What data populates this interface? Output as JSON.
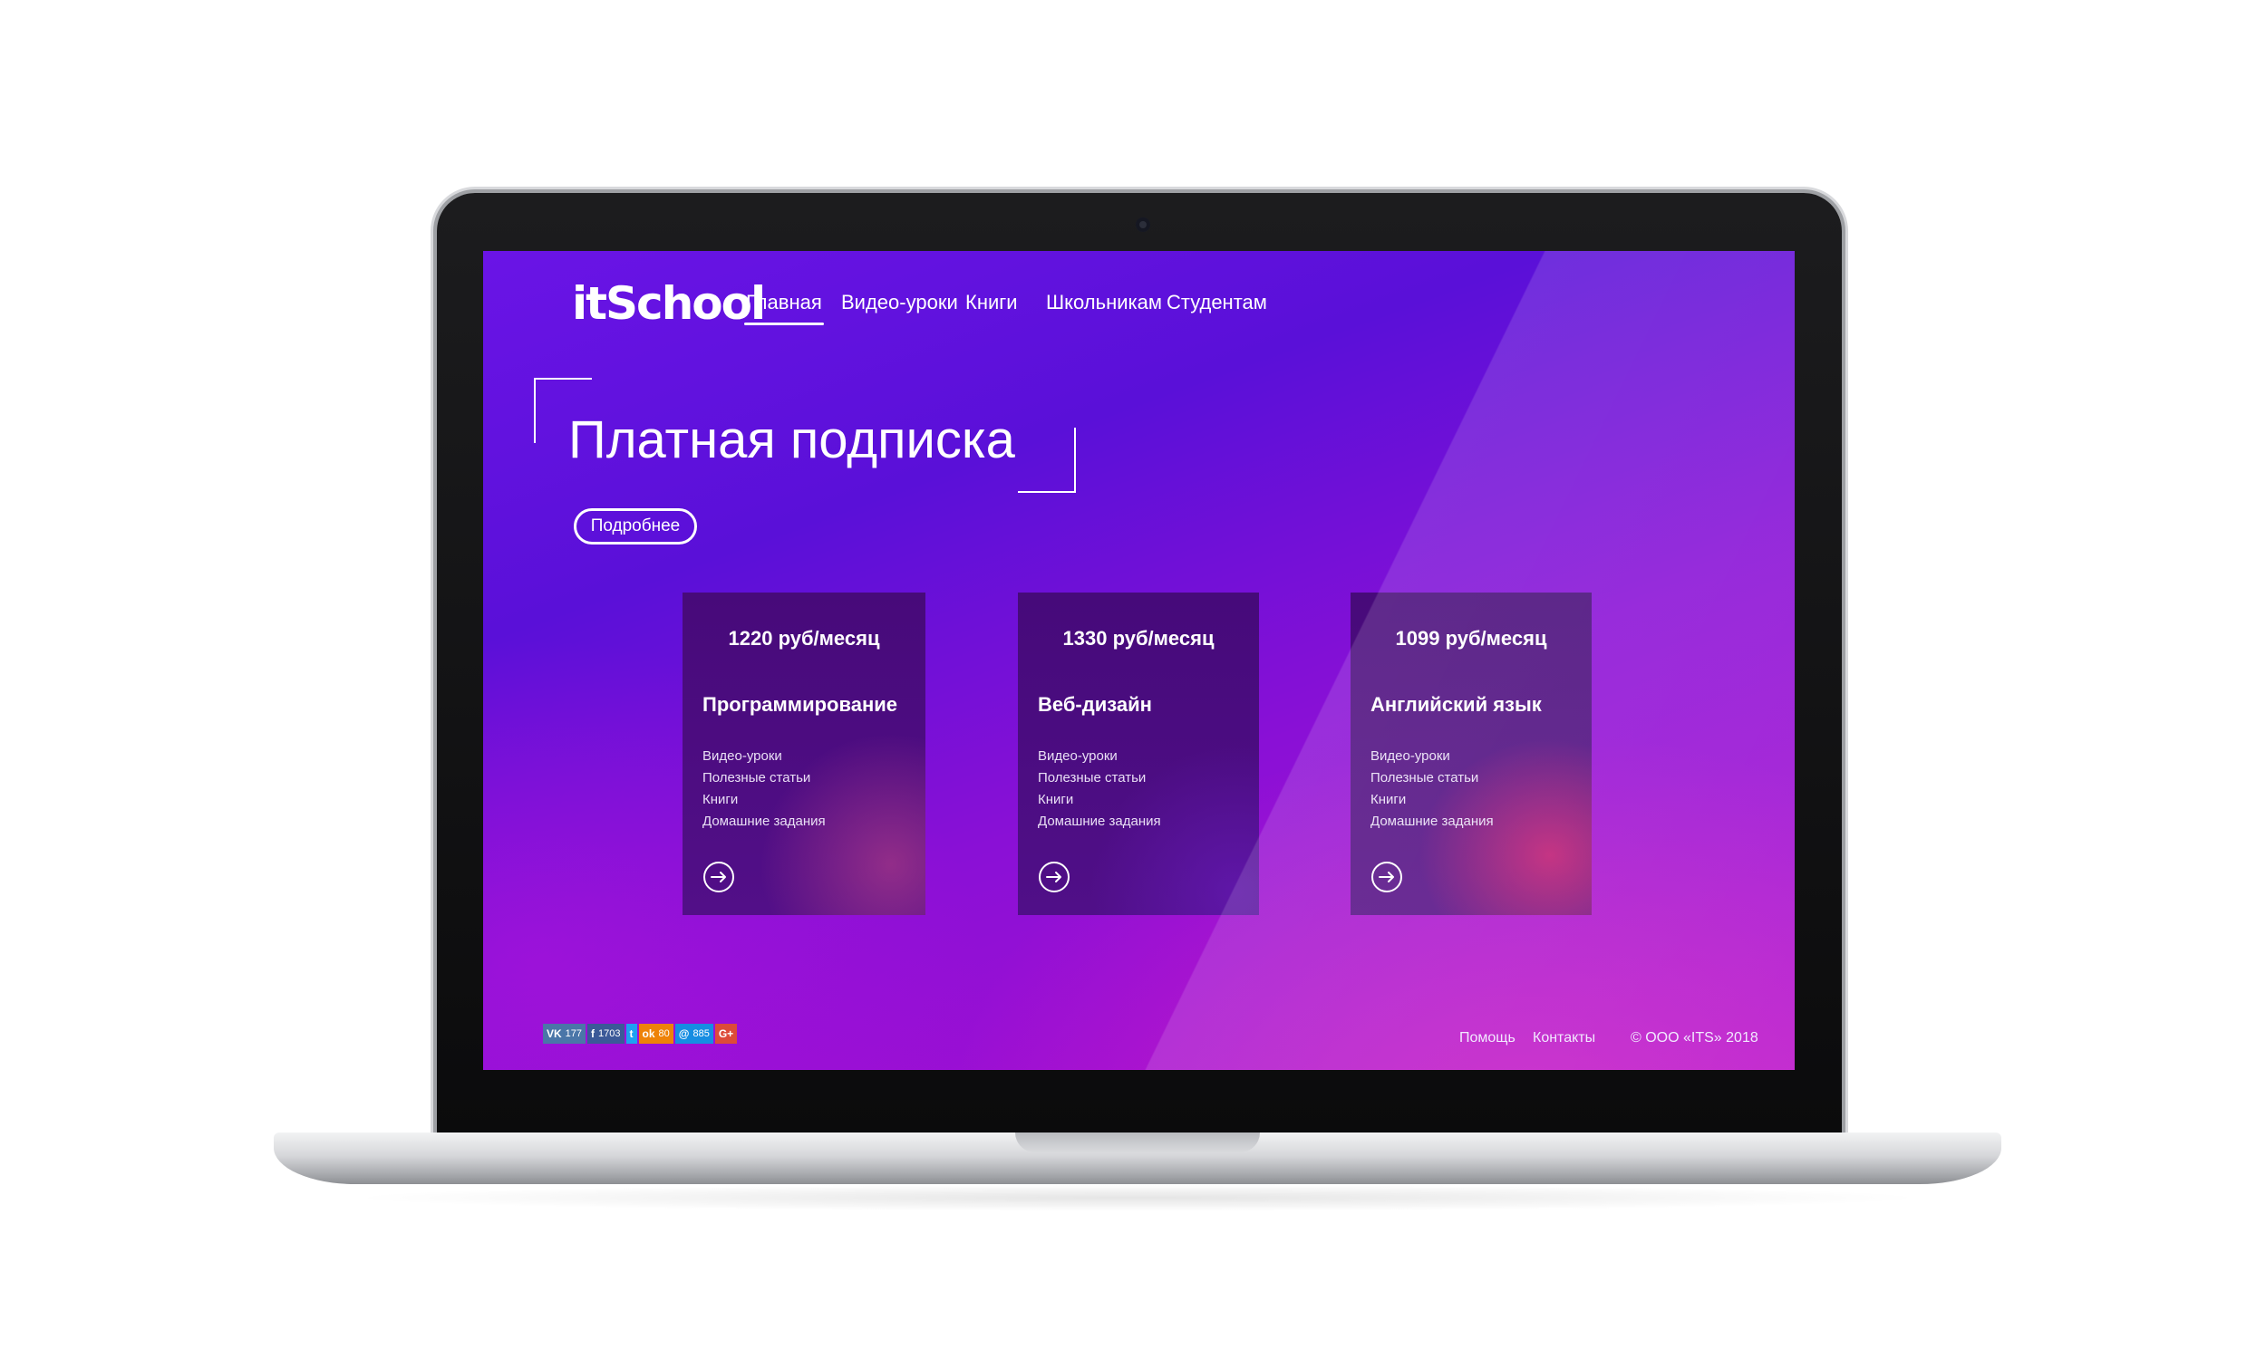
{
  "brand": {
    "logo": "itSchool"
  },
  "nav": {
    "items": [
      {
        "label": "Главная",
        "active": true
      },
      {
        "label": "Видео-уроки",
        "active": false
      },
      {
        "label": "Книги",
        "active": false
      },
      {
        "label": "Школьникам",
        "active": false
      },
      {
        "label": "Студентам",
        "active": false
      }
    ]
  },
  "hero": {
    "title": "Платная подписка",
    "more_label": "Подробнее"
  },
  "cards": [
    {
      "price": "1220 руб/месяц",
      "title": "Программирование",
      "features": [
        "Видео-уроки",
        "Полезные статьи",
        "Книги",
        "Домашние задания"
      ],
      "arrow_icon": "arrow-right-circle-icon"
    },
    {
      "price": "1330 руб/месяц",
      "title": "Веб-дизайн",
      "features": [
        "Видео-уроки",
        "Полезные статьи",
        "Книги",
        "Домашние задания"
      ],
      "arrow_icon": "arrow-right-circle-icon"
    },
    {
      "price": "1099 руб/месяц",
      "title": "Английский язык",
      "features": [
        "Видео-уроки",
        "Полезные статьи",
        "Книги",
        "Домашние задания"
      ],
      "arrow_icon": "arrow-right-circle-icon"
    }
  ],
  "social": [
    {
      "network": "vk",
      "icon": "vk-icon",
      "glyph": "VK",
      "count": "177",
      "color": "#4a76a8"
    },
    {
      "network": "facebook",
      "icon": "facebook-icon",
      "glyph": "f",
      "count": "1703",
      "color": "#3b5998"
    },
    {
      "network": "twitter",
      "icon": "twitter-icon",
      "glyph": "t",
      "count": "",
      "color": "#1da1f2"
    },
    {
      "network": "odnoklassniki",
      "icon": "odnoklassniki-icon",
      "glyph": "ok",
      "count": "80",
      "color": "#ee8208"
    },
    {
      "network": "moimir",
      "icon": "moimir-icon",
      "glyph": "@",
      "count": "885",
      "color": "#168de2"
    },
    {
      "network": "googleplus",
      "icon": "googleplus-icon",
      "glyph": "G+",
      "count": "",
      "color": "#dd4b39"
    }
  ],
  "footer": {
    "help": "Помощь",
    "contacts": "Контакты",
    "copyright": "© ООО «ITS» 2018"
  }
}
